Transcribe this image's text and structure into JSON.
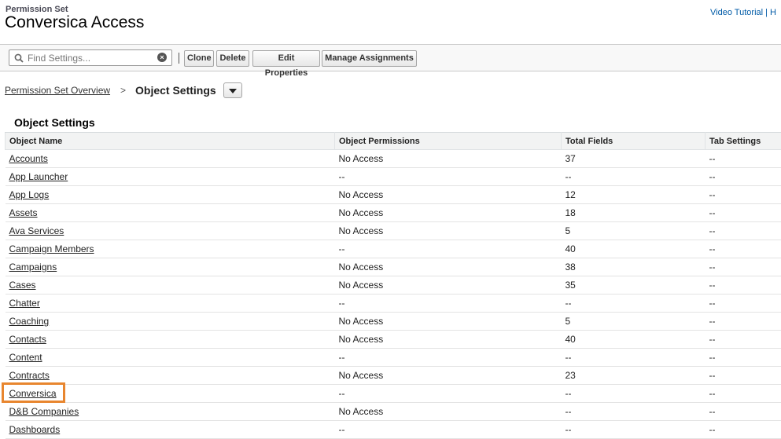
{
  "header": {
    "label": "Permission Set",
    "title": "Conversica Access",
    "help_links": "Video Tutorial | H"
  },
  "toolbar": {
    "search_placeholder": "Find Settings...",
    "clone_label": "Clone",
    "delete_label": "Delete",
    "edit_properties_label": "Edit Properties",
    "manage_assignments_label": "Manage Assignments"
  },
  "breadcrumb": {
    "overview_label": "Permission Set Overview",
    "separator": ">",
    "current_label": "Object Settings"
  },
  "section": {
    "title": "Object Settings"
  },
  "table": {
    "columns": [
      "Object Name",
      "Object Permissions",
      "Total Fields",
      "Tab Settings"
    ],
    "rows": [
      {
        "name": "Accounts",
        "permissions": "No Access",
        "fields": "37",
        "tab": "--"
      },
      {
        "name": "App Launcher",
        "permissions": "--",
        "fields": "--",
        "tab": "--"
      },
      {
        "name": "App Logs",
        "permissions": "No Access",
        "fields": "12",
        "tab": "--"
      },
      {
        "name": "Assets",
        "permissions": "No Access",
        "fields": "18",
        "tab": "--"
      },
      {
        "name": "Ava Services",
        "permissions": "No Access",
        "fields": "5",
        "tab": "--"
      },
      {
        "name": "Campaign Members",
        "permissions": "--",
        "fields": "40",
        "tab": "--"
      },
      {
        "name": "Campaigns",
        "permissions": "No Access",
        "fields": "38",
        "tab": "--"
      },
      {
        "name": "Cases",
        "permissions": "No Access",
        "fields": "35",
        "tab": "--"
      },
      {
        "name": "Chatter",
        "permissions": "--",
        "fields": "--",
        "tab": "--"
      },
      {
        "name": "Coaching",
        "permissions": "No Access",
        "fields": "5",
        "tab": "--"
      },
      {
        "name": "Contacts",
        "permissions": "No Access",
        "fields": "40",
        "tab": "--"
      },
      {
        "name": "Content",
        "permissions": "--",
        "fields": "--",
        "tab": "--"
      },
      {
        "name": "Contracts",
        "permissions": "No Access",
        "fields": "23",
        "tab": "--"
      },
      {
        "name": "Conversica",
        "permissions": "--",
        "fields": "--",
        "tab": "--"
      },
      {
        "name": "D&B Companies",
        "permissions": "No Access",
        "fields": "--",
        "tab": "--"
      },
      {
        "name": "Dashboards",
        "permissions": "--",
        "fields": "--",
        "tab": "--"
      }
    ]
  },
  "colors": {
    "highlight": "#e8862f",
    "link": "#015ba7"
  }
}
